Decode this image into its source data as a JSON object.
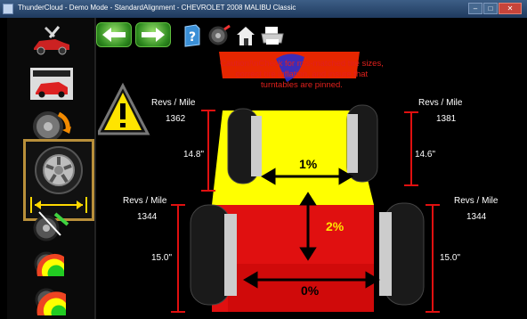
{
  "window": {
    "title": "ThunderCloud - Demo Mode - StandardAlignment - CHEVROLET 2008 MALIBU Classic",
    "buttons": {
      "minimize": "–",
      "maximize": "□",
      "close": "✕"
    }
  },
  "toolbar": {
    "back_icon": "arrow-left-icon",
    "forward_icon": "arrow-right-icon",
    "icons": [
      "help-icon",
      "settings-icon",
      "home-icon",
      "print-icon"
    ]
  },
  "sidebar": {
    "items": [
      {
        "name": "vehicle-select",
        "icon": "car-tools-icon"
      },
      {
        "name": "specifications",
        "icon": "specs-car-icon"
      },
      {
        "name": "runout",
        "icon": "wheel-rotate-icon"
      },
      {
        "name": "tire-size",
        "icon": "tire-size-icon",
        "active": true
      },
      {
        "name": "caster-swing",
        "icon": "caster-icon"
      },
      {
        "name": "measure",
        "icon": "measure-gauge-icon"
      },
      {
        "name": "adjust",
        "icon": "adjust-gauge-icon"
      }
    ]
  },
  "warning": {
    "message": "Caution!\\nCheck for mis-matched tire sizes, correct tire inflation, and insure that turntables are pinned."
  },
  "tires": {
    "front_left": {
      "label": "Revs / Mile",
      "value": "1362"
    },
    "front_right": {
      "label": "Revs / Mile",
      "value": "1381"
    },
    "rear_left": {
      "label": "Revs / Mile",
      "value": "1344"
    },
    "rear_right": {
      "label": "Revs / Mile",
      "value": "1344"
    }
  },
  "heights": {
    "front_left": "14.8\"",
    "front_right": "14.6\"",
    "rear_left": "15.0\"",
    "rear_right": "15.0\""
  },
  "differences": {
    "front": "1%",
    "side": "2%",
    "rear": "0%"
  },
  "colors": {
    "ok": "#ffff00",
    "bad": "#e01010",
    "caution_text": "#e2201c",
    "accent_frame": "#b88f3a"
  }
}
